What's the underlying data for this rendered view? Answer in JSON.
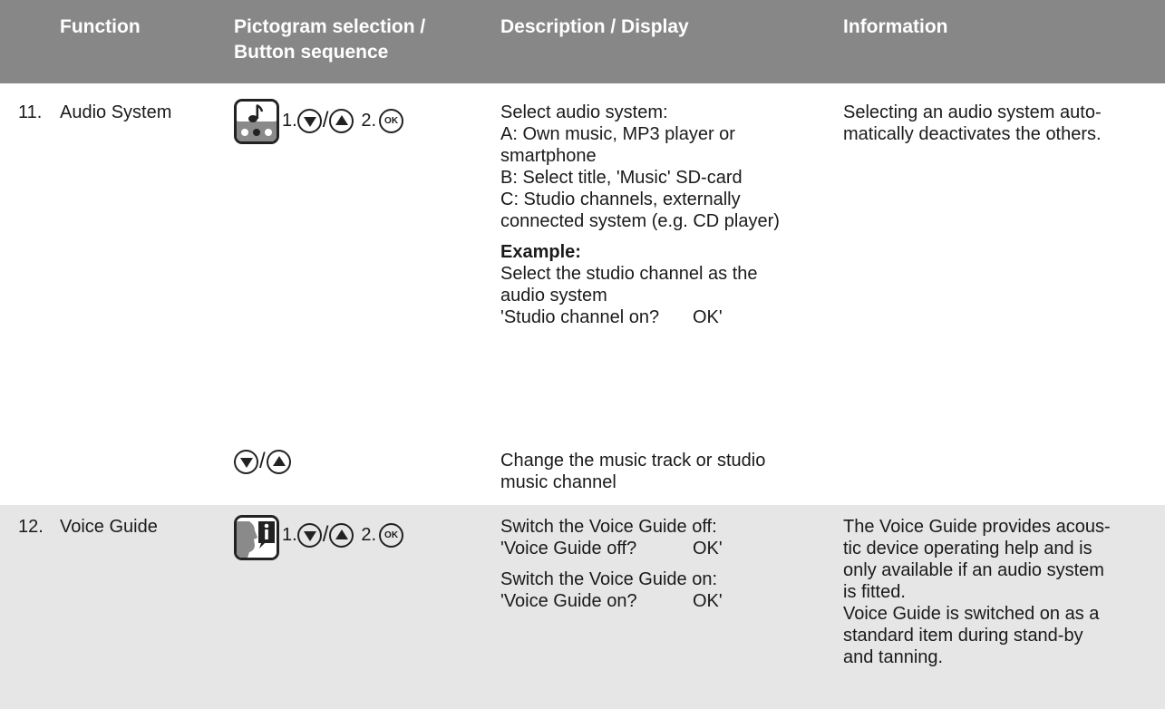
{
  "header": {
    "function": "Function",
    "pictogram_line1": "Pictogram selection /",
    "pictogram_line2": "Button sequence",
    "description": "Description / Display",
    "information": "Information"
  },
  "rows": [
    {
      "number": "11.",
      "function": "Audio System",
      "pictogram_icon": "music-note-icon",
      "sequence": {
        "step1": "1.",
        "slash": "/",
        "step2": "2.",
        "ok": "OK"
      },
      "description_lines": [
        "Select audio system:",
        "A: Own music, MP3 player or",
        "smartphone",
        "B: Select title, 'Music' SD-card",
        "C: Studio channels, externally",
        "connected system (e.g. CD player)"
      ],
      "example_heading": "Example:",
      "example_lines": [
        "Select the studio channel as the",
        "audio system"
      ],
      "example_prompt": "'Studio channel on?",
      "example_prompt_ok": "OK'",
      "secondary_sequence_slash": "/",
      "secondary_lines": [
        "Change the music track or studio",
        "music channel"
      ],
      "info_lines": [
        "Selecting an audio system auto-",
        "matically deactivates the others."
      ]
    },
    {
      "number": "12.",
      "function": "Voice Guide",
      "pictogram_icon": "voice-guide-icon",
      "sequence": {
        "step1": "1.",
        "slash": "/",
        "step2": "2.",
        "ok": "OK"
      },
      "description_off_line": "Switch the Voice Guide off:",
      "description_off_prompt": "'Voice Guide off?",
      "description_off_ok": "OK'",
      "description_on_line": "Switch the Voice Guide on:",
      "description_on_prompt": "'Voice Guide on?",
      "description_on_ok": "OK'",
      "info_lines": [
        "The Voice Guide provides acous-",
        "tic device operating help and is",
        "only available if an audio system",
        "is fitted.",
        "Voice Guide is switched on as a",
        "standard item during stand-by",
        "and tanning."
      ]
    }
  ]
}
